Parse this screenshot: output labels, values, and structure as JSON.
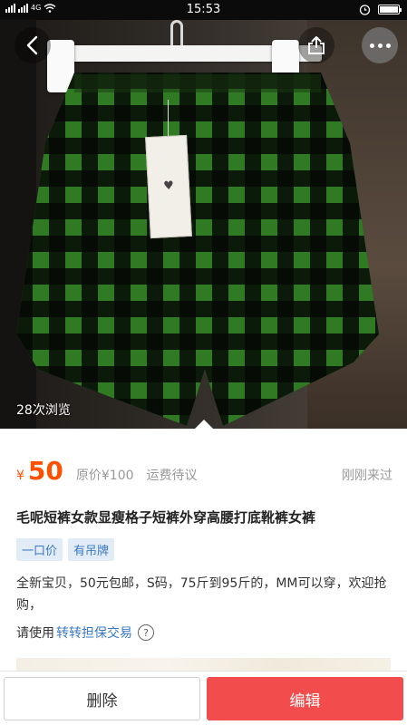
{
  "status_bar": {
    "time": "15:53",
    "network_label": "4G",
    "battery_level": 0.9
  },
  "photo": {
    "view_count": "28次浏览"
  },
  "icons": {
    "back": "back-arrow-icon",
    "share": "share-icon",
    "more": "more-dots-icon",
    "help": "question-circle-icon"
  },
  "listing": {
    "currency_symbol": "¥",
    "price": "50",
    "original_price": "原价¥100",
    "shipping": "运费待议",
    "last_seen": "刚刚来过",
    "title": "毛呢短裤女款显瘦格子短裤外穿高腰打底靴裤女裤",
    "tags": [
      "一口价",
      "有吊牌"
    ],
    "description": "全新宝贝，50元包邮，S码，75斤到95斤的，MM可以穿，欢迎抢购，",
    "guarantee_prefix": "请使用",
    "guarantee_link": "转转担保交易"
  },
  "actions": {
    "delete_label": "删除",
    "edit_label": "编辑"
  },
  "colors": {
    "price": "#ff5000",
    "edit_button": "#f24c4c",
    "tag_text": "#3a78c3",
    "tag_background": "#e2ecf6"
  }
}
